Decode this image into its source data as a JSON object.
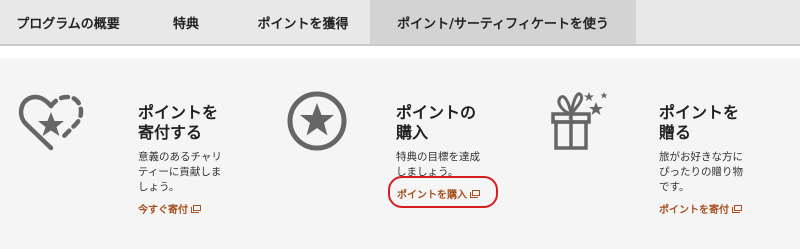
{
  "tabs": [
    {
      "label": "プログラムの概要"
    },
    {
      "label": "特典"
    },
    {
      "label": "ポイントを獲得"
    },
    {
      "label": "ポイント/サーティフィケートを使う"
    }
  ],
  "columns": [
    {
      "icon": "heart-star-icon",
      "title": "ポイントを\n寄付する",
      "description": "意義のあるチャリ\nティーに貢献しま\nしょう。",
      "link": "今すぐ寄付"
    },
    {
      "icon": "star-circle-icon",
      "title": "ポイントの\n購入",
      "description": "特典の目標を達成\nしましょう。",
      "link": "ポイントを購入"
    },
    {
      "icon": "gift-icon",
      "title": "ポイントを\n贈る",
      "description": "旅がお好きな方に\nぴったりの贈り物\nです。",
      "link": "ポイントを寄付"
    }
  ],
  "colors": {
    "link": "#a6501f",
    "highlight": "#d81e1e",
    "icon": "#666666"
  }
}
